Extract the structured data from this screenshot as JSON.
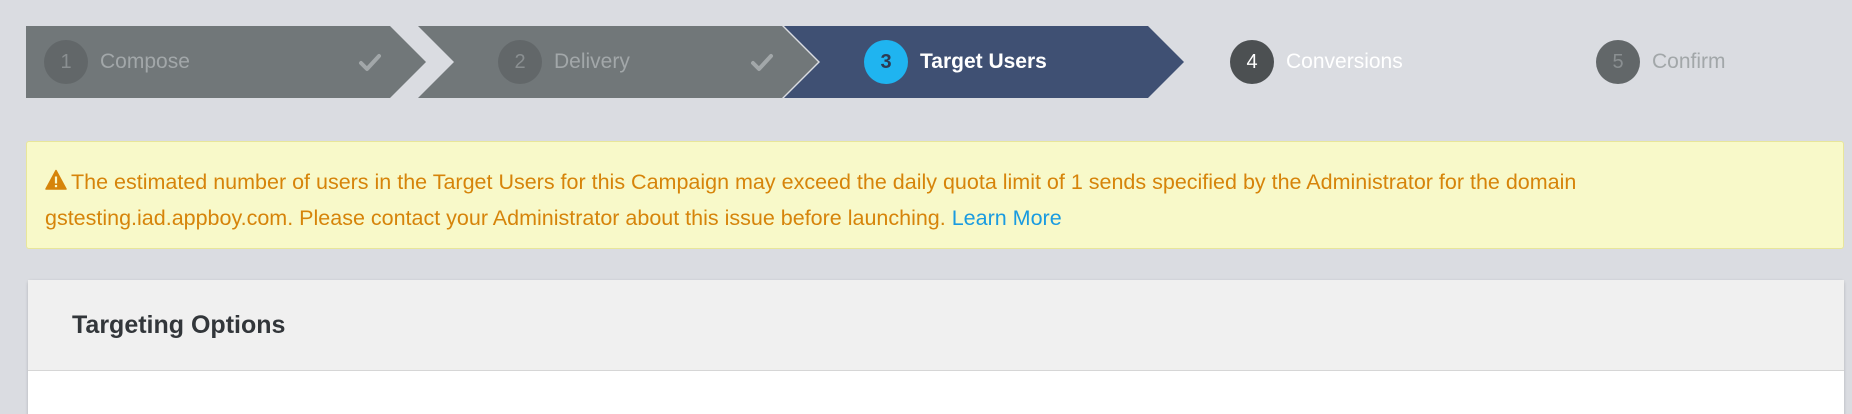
{
  "wizard": {
    "steps": [
      {
        "number": "1",
        "label": "Compose",
        "state": "done",
        "icon": "check-icon"
      },
      {
        "number": "2",
        "label": "Delivery",
        "state": "done",
        "icon": "check-icon"
      },
      {
        "number": "3",
        "label": "Target Users",
        "state": "active"
      },
      {
        "number": "4",
        "label": "Conversions",
        "state": "upcoming"
      },
      {
        "number": "5",
        "label": "Confirm",
        "state": "upcoming-dim"
      }
    ]
  },
  "warning": {
    "icon": "warning-triangle-icon",
    "message": "The estimated number of users in the Target Users for this Campaign may exceed the daily quota limit of 1 sends specified by the Administrator for the domain gstesting.iad.appboy.com. Please contact your Administrator about this issue before launching.",
    "link_label": "Learn More"
  },
  "panel": {
    "title": "Targeting Options"
  },
  "colors": {
    "page_bg": "#dadce1",
    "step_inactive": "#717779",
    "step_active": "#3f5073",
    "step_active_badge": "#1fb4f0",
    "warning_bg": "#f8f9c9",
    "warning_text": "#d6840a",
    "link": "#1a9be0"
  }
}
